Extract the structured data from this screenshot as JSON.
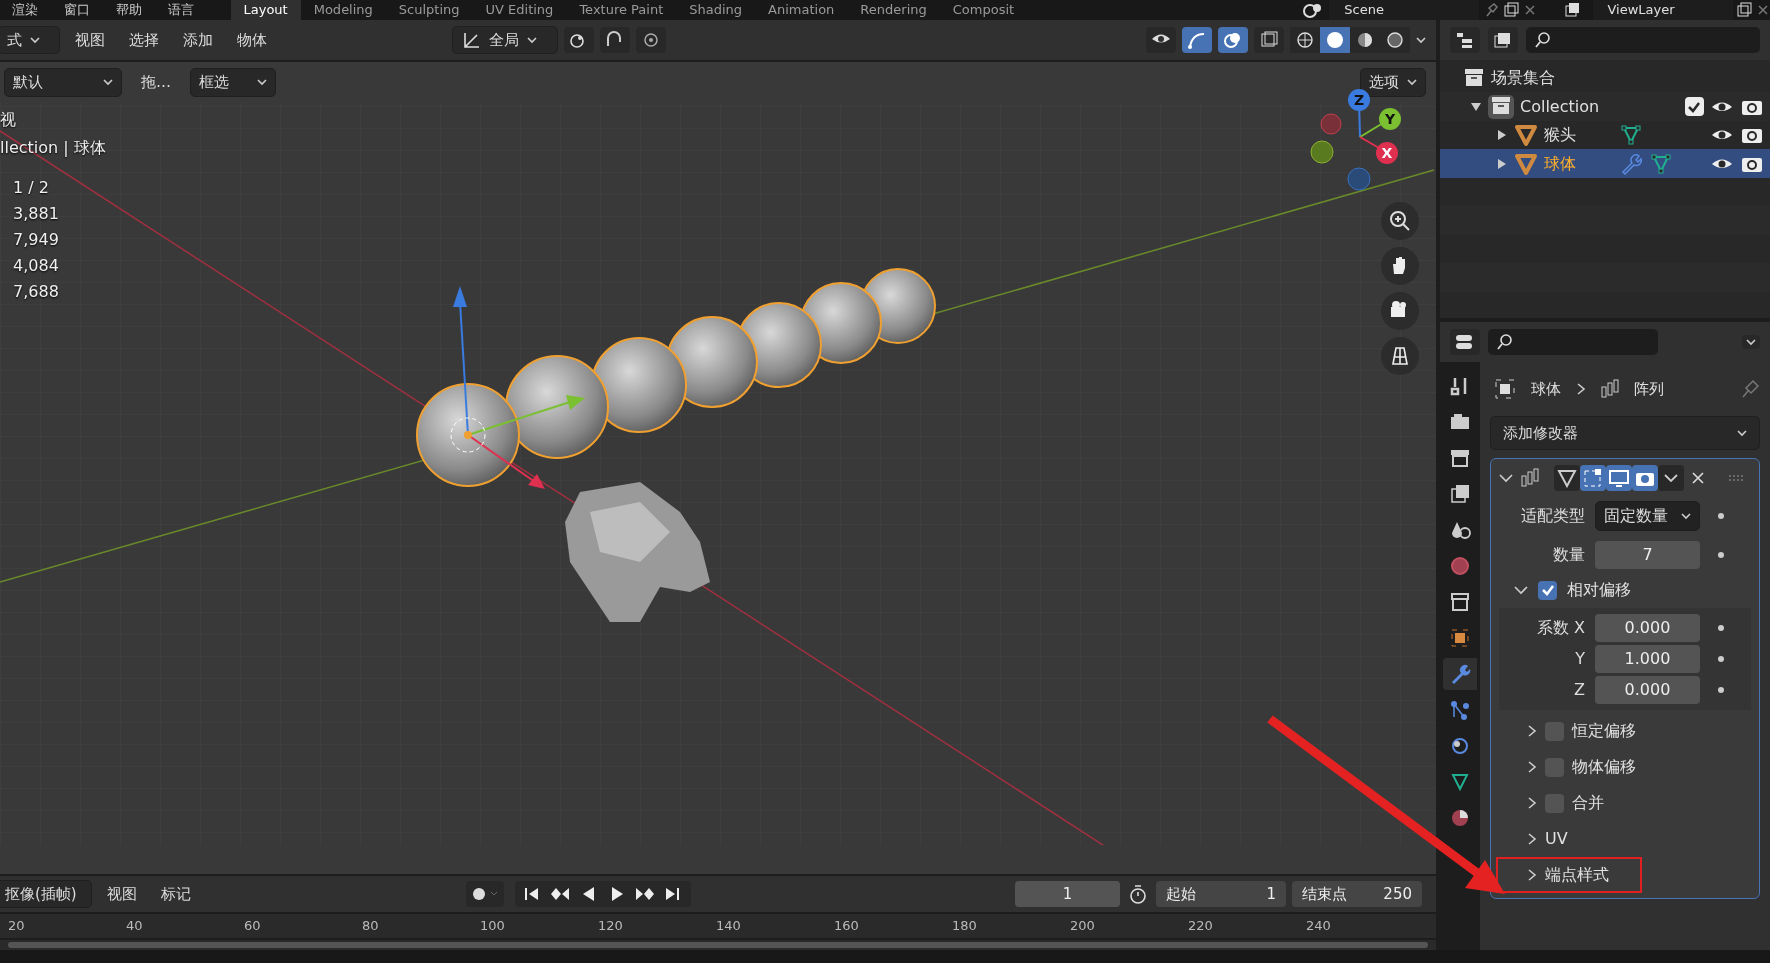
{
  "top_menu": [
    "渲染",
    "窗口",
    "帮助",
    "语言"
  ],
  "workspace_tabs": [
    {
      "label": "Layout",
      "selected": true
    },
    {
      "label": "Modeling",
      "selected": false
    },
    {
      "label": "Sculpting",
      "selected": false
    },
    {
      "label": "UV Editing",
      "selected": false
    },
    {
      "label": "Texture Paint",
      "selected": false
    },
    {
      "label": "Shading",
      "selected": false
    },
    {
      "label": "Animation",
      "selected": false
    },
    {
      "label": "Rendering",
      "selected": false
    },
    {
      "label": "Composit",
      "selected": false
    }
  ],
  "scene": "Scene",
  "view_layer": "ViewLayer",
  "header": {
    "mode": "式",
    "menus": [
      "视图",
      "选择",
      "添加",
      "物体"
    ],
    "orientation": "全局",
    "shading": [
      {
        "selected": false
      },
      {
        "selected": true
      },
      {
        "selected": false
      },
      {
        "selected": false
      }
    ]
  },
  "tool_header": {
    "brush": "默认",
    "drag": "拖…",
    "select": "框选",
    "options": "选项"
  },
  "viewport": {
    "view_name": "视",
    "collection_line": "llection | 球体",
    "stats": [
      "1 / 2",
      "3,881",
      "7,949",
      "4,084",
      "7,688"
    ],
    "gizmo": [
      "Z",
      "Y",
      "X"
    ]
  },
  "outliner": {
    "scene_collection": "场景集合",
    "items": [
      {
        "name": "Collection",
        "kind": "collection",
        "expanded": true,
        "selected": false,
        "checked": true,
        "children": [
          {
            "name": "猴头",
            "kind": "mesh",
            "selected": false,
            "has_modifier": false,
            "expanded": false
          },
          {
            "name": "球体",
            "kind": "mesh",
            "selected": true,
            "has_modifier": true,
            "expanded": false
          }
        ]
      }
    ]
  },
  "property_tabs": [
    {
      "selected": false
    },
    {
      "selected": false
    },
    {
      "selected": false
    },
    {
      "selected": false
    },
    {
      "selected": false
    },
    {
      "selected": false
    },
    {
      "selected": false
    },
    {
      "selected": false
    },
    {
      "selected": true
    },
    {
      "selected": false
    },
    {
      "selected": false
    },
    {
      "selected": false
    },
    {
      "selected": false
    }
  ],
  "properties": {
    "breadcrumb": [
      "球体",
      "阵列"
    ],
    "add_modifier": "添加修改器",
    "fields": [
      {
        "label": "适配类型",
        "value": "固定数量",
        "kind": "dropdown"
      },
      {
        "label": "数量",
        "value": "7",
        "kind": "number"
      }
    ],
    "relative_offset": {
      "label": "相对偏移",
      "checked": true,
      "expanded": true,
      "fields": [
        {
          "label": "系数 X",
          "value": "0.000"
        },
        {
          "label": "Y",
          "value": "1.000"
        },
        {
          "label": "Z",
          "value": "0.000"
        }
      ]
    },
    "subpanels": [
      {
        "label": "恒定偏移",
        "kind": "checkbox",
        "checked": false,
        "highlighted": false
      },
      {
        "label": "物体偏移",
        "kind": "checkbox",
        "checked": false,
        "highlighted": false
      },
      {
        "label": "合并",
        "kind": "checkbox",
        "checked": false,
        "highlighted": false
      },
      {
        "label": "UV",
        "kind": "plain",
        "highlighted": false
      },
      {
        "label": "端点样式",
        "kind": "plain",
        "highlighted": true
      }
    ]
  },
  "timeline": {
    "keying": "抠像(插帧)",
    "menus": [
      "视图",
      "标记"
    ],
    "current_frame": "1",
    "start_label": "起始",
    "start": "1",
    "end_label": "结束点",
    "end": "250",
    "ruler": [
      "20",
      "40",
      "60",
      "80",
      "100",
      "120",
      "140",
      "160",
      "180",
      "200",
      "220",
      "240"
    ]
  }
}
